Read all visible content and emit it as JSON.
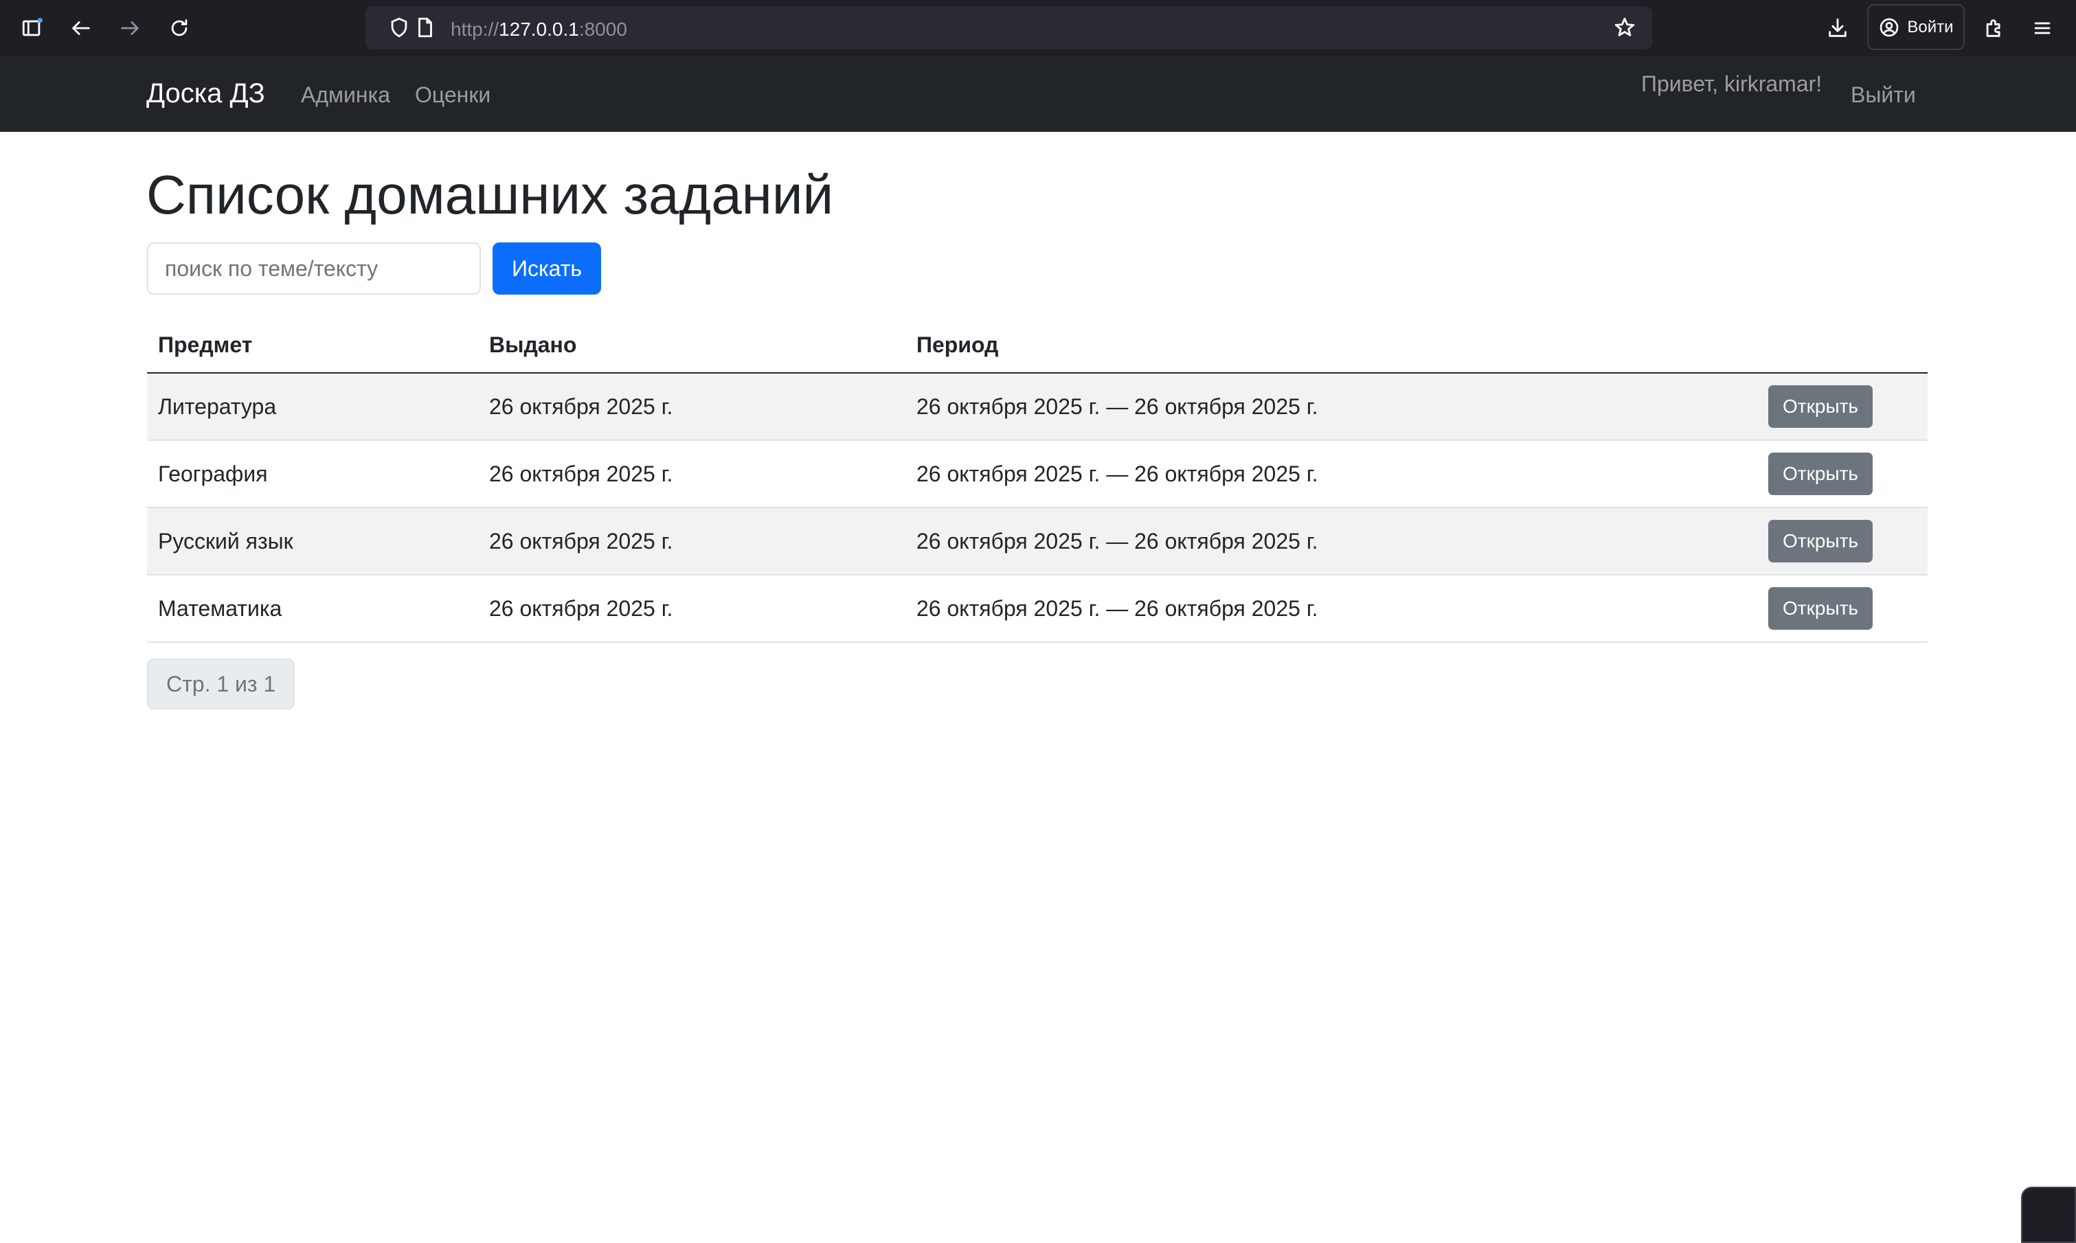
{
  "browser": {
    "url_scheme": "http://",
    "url_host": "127.0.0.1",
    "url_port": ":8000",
    "login_label": "Войти"
  },
  "navbar": {
    "brand": "Доска ДЗ",
    "links": [
      "Админка",
      "Оценки"
    ],
    "greeting": "Привет, kirkramar!",
    "logout": "Выйти"
  },
  "page": {
    "title": "Список домашних заданий",
    "search_placeholder": "поиск по теме/тексту",
    "search_button": "Искать"
  },
  "table": {
    "headers": [
      "Предмет",
      "Выдано",
      "Период",
      ""
    ],
    "rows": [
      {
        "subject": "Литература",
        "issued": "26 октября 2025 г.",
        "period": "26 октября 2025 г. — 26 октября 2025 г.",
        "action": "Открыть"
      },
      {
        "subject": "География",
        "issued": "26 октября 2025 г.",
        "period": "26 октября 2025 г. — 26 октября 2025 г.",
        "action": "Открыть"
      },
      {
        "subject": "Русский язык",
        "issued": "26 октября 2025 г.",
        "period": "26 октября 2025 г. — 26 октября 2025 г.",
        "action": "Открыть"
      },
      {
        "subject": "Математика",
        "issued": "26 октября 2025 г.",
        "period": "26 октября 2025 г. — 26 октября 2025 г.",
        "action": "Открыть"
      }
    ]
  },
  "pagination": {
    "label": "Стр. 1 из 1"
  },
  "icons": [
    "sidebar-icon",
    "back-arrow-icon",
    "forward-arrow-icon",
    "reload-icon",
    "shield-icon",
    "page-icon",
    "star-icon",
    "download-icon",
    "account-icon",
    "extensions-icon",
    "menu-icon"
  ],
  "colors": {
    "primary": "#0d6efd",
    "secondary": "#6c757d",
    "navbar": "#212529",
    "browser_chrome": "#1f1e25"
  }
}
